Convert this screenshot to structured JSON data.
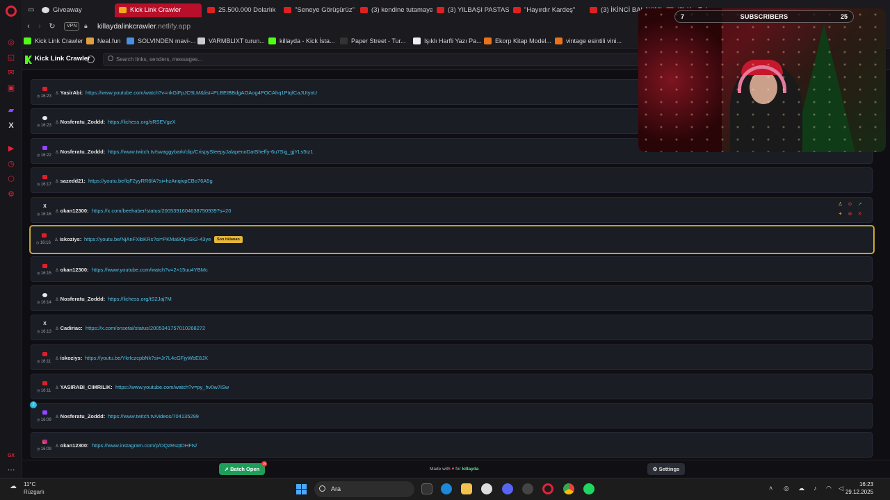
{
  "browser": {
    "tabs": [
      {
        "label": "Giveaway"
      },
      {
        "label": "Kick Link Crawler"
      },
      {
        "label": "25.500.000 Dolarlık"
      },
      {
        "label": "\"Seneye Görüşürüz\""
      },
      {
        "label": "(3) kendine tutamaya"
      },
      {
        "label": "(3) YILBAŞI PASTASI"
      },
      {
        "label": "\"Hayırdır Kardeş\""
      },
      {
        "label": "(3) İKİNCİ BALAYIMIZ"
      },
      {
        "label": "(3) YouTube"
      }
    ],
    "vpn_label": "VPN",
    "url_host": "killaydalinkcrawler",
    "url_domain": ".netlify.app",
    "bookmarks": [
      {
        "label": "Kick Link Crawler",
        "color": "#53fc18"
      },
      {
        "label": "Neal.fun",
        "color": "#e0a040"
      },
      {
        "label": "SOLVINDEN mavi-...",
        "color": "#4a90e2"
      },
      {
        "label": "VARMBLIXT turun...",
        "color": "#cccccc"
      },
      {
        "label": "killayda - Kick İsta...",
        "color": "#53fc18"
      },
      {
        "label": "Paper Street - Tur...",
        "color": "#333333"
      },
      {
        "label": "Işıklı Harfli Yazı Pa...",
        "color": "#eeeeee"
      },
      {
        "label": "Ekorp Kitap Model...",
        "color": "#e8731a"
      },
      {
        "label": "vintage esintili vini...",
        "color": "#e8731a"
      }
    ]
  },
  "app": {
    "title": "Kick Link Crawler",
    "search_placeholder": "Search links, senders, messages...",
    "links": [
      {
        "platform": "youtube",
        "time": "16:23",
        "sender": "YasirAbi:",
        "url": "https://www.youtube.com/watch?v=nkGiFpJC9LM&list=PLBEIBBdgAOAog4POCAhq1PtqfCaJUtyoU",
        "tag": ""
      },
      {
        "platform": "lichess",
        "time": "16:23",
        "sender": "Nosferatu_Zoddd:",
        "url": "https://lichess.org/sRSEVgzX",
        "tag": ""
      },
      {
        "platform": "twitch",
        "time": "16:22",
        "sender": "Nosferatu_Zoddd:",
        "url": "https://www.twitch.tv/swaggybark/clip/CrispySleepyJalapenoDatSheffy-6u7Sig_gjYLs5tz1",
        "tag": ""
      },
      {
        "platform": "youtube",
        "time": "16:17",
        "sender": "sazedd21:",
        "url": "https://youtu.be/lqF2yyRR6fA?si=hzAnqivpCBo76A5g",
        "tag": ""
      },
      {
        "platform": "x",
        "time": "16:16",
        "sender": "okan12300:",
        "url": "https://x.com/beehaber/status/2005391604638750939?s=20",
        "tag": ""
      },
      {
        "platform": "youtube",
        "time": "16:16",
        "sender": "iskoziys:",
        "url": "https://youtu.be/NjAnFXibKRs?si=PKMa9OjHSk2-43ye",
        "tag": "Son tıklanan"
      },
      {
        "platform": "youtube",
        "time": "16:15",
        "sender": "okan12300:",
        "url": "https://www.youtube.com/watch?v=2×15uu4YBMc",
        "tag": ""
      },
      {
        "platform": "lichess",
        "time": "16:14",
        "sender": "Nosferatu_Zoddd:",
        "url": "https://lichess.org/tS2Jaj7M",
        "tag": ""
      },
      {
        "platform": "x",
        "time": "16:13",
        "sender": "Cadiriac:",
        "url": "https://x.com/onsetai/status/2005341757010268272",
        "tag": ""
      },
      {
        "platform": "youtube",
        "time": "16:11",
        "sender": "iskoziys:",
        "url": "https://youtu.be/YkrIczcpbNk?si=Jr7L4cGFjyWbE8JX",
        "tag": ""
      },
      {
        "platform": "youtube",
        "time": "16:11",
        "sender": "YASIRABI_CIMRILIK:",
        "url": "https://www.youtube.com/watch?v=py_hv0w7iSw",
        "tag": ""
      },
      {
        "platform": "twitch",
        "time": "16:09",
        "sender": "Nosferatu_Zoddd:",
        "url": "https://www.twitch.tv/videos/704135299",
        "tag": ""
      },
      {
        "platform": "instagram",
        "time": "16:09",
        "sender": "okan12300:",
        "url": "https://www.instagram.com/p/DQzRsqtDHFN/",
        "tag": ""
      }
    ],
    "unread_badge": "2",
    "footer": {
      "batch_label": "Batch Open",
      "batch_count": "16",
      "made_with_prefix": "Made with",
      "made_with_for": "for",
      "made_with_author": "killayda",
      "settings_label": "Settings"
    }
  },
  "stream_overlay": {
    "left_count": "7",
    "label": "SUBSCRIBERS",
    "right_count": "25"
  },
  "taskbar": {
    "temperature": "11°C",
    "weather": "Rüzgarlı",
    "search_label": "Ara",
    "time": "16:23",
    "date": "29.12.2025"
  }
}
